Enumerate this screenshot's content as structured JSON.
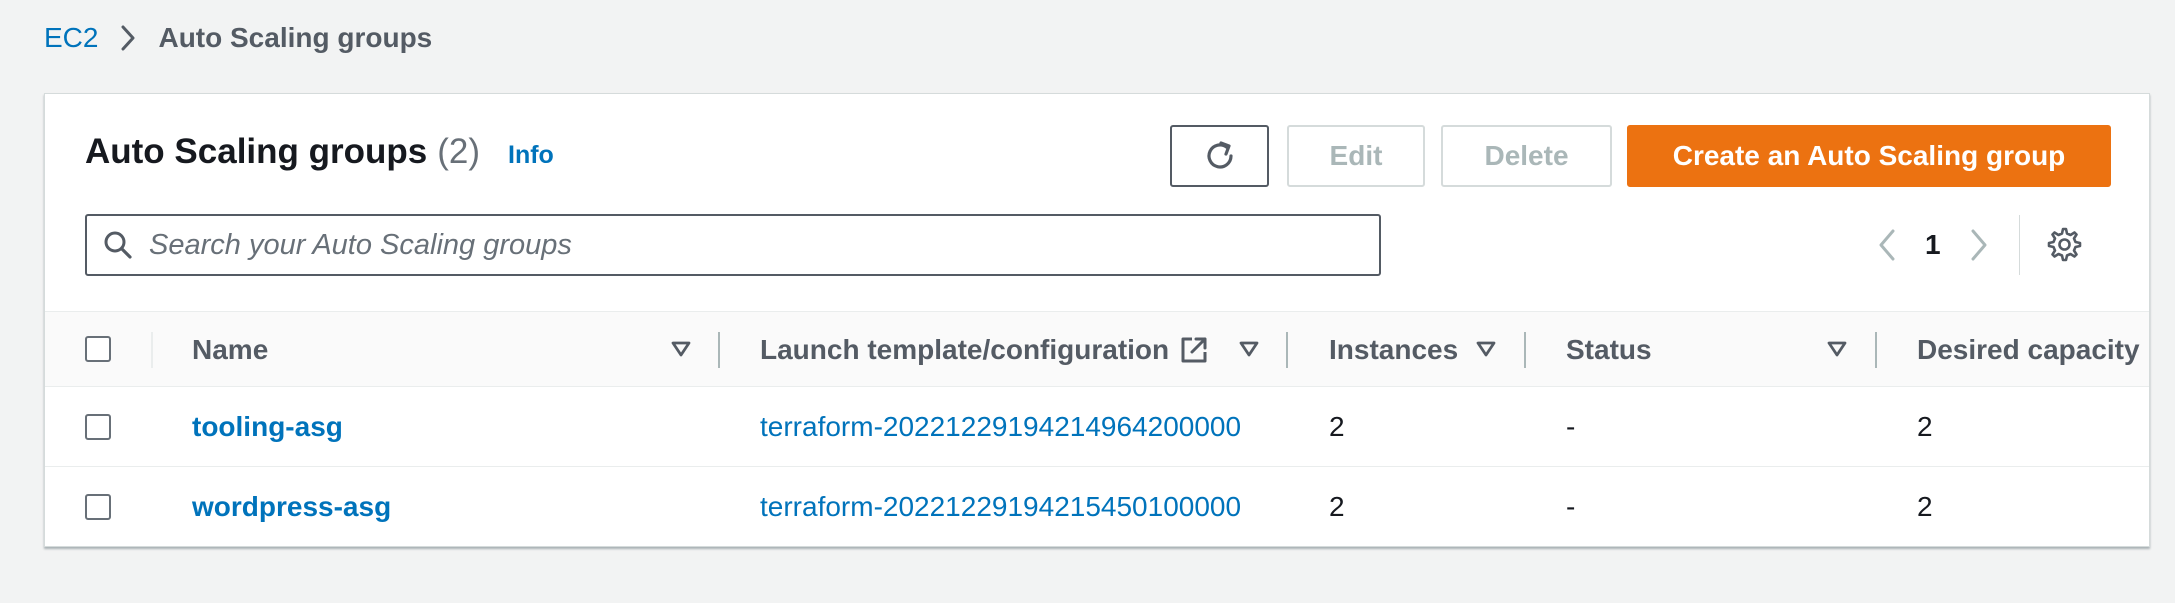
{
  "breadcrumb": {
    "root": "EC2",
    "current": "Auto Scaling groups"
  },
  "header": {
    "title": "Auto Scaling groups",
    "count": "(2)",
    "info": "Info"
  },
  "actions": {
    "refresh_icon": "refresh-icon",
    "edit": "Edit",
    "delete": "Delete",
    "create": "Create an Auto Scaling group"
  },
  "search": {
    "placeholder": "Search your Auto Scaling groups"
  },
  "pagination": {
    "current_page": "1"
  },
  "table": {
    "columns": {
      "name": "Name",
      "launch_template": "Launch template/configuration",
      "instances": "Instances",
      "status": "Status",
      "desired_capacity": "Desired capacity"
    },
    "rows": [
      {
        "name": "tooling-asg",
        "launch_template": "terraform-20221229194214964200000",
        "instances": "2",
        "status": "-",
        "desired_capacity": "2"
      },
      {
        "name": "wordpress-asg",
        "launch_template": "terraform-20221229194215450100000",
        "instances": "2",
        "status": "-",
        "desired_capacity": "2"
      }
    ]
  },
  "colors": {
    "link": "#0073bb",
    "primary_button": "#ec7211",
    "background": "#f2f3f3",
    "text": "#16191f",
    "muted": "#545b64",
    "disabled": "#aab7b8"
  }
}
